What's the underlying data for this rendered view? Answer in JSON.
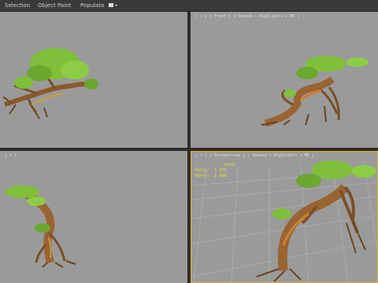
{
  "menubar": {
    "items": [
      "Selection",
      "Object Paint",
      "Populate"
    ],
    "extra_icon": "camera-dropdown-icon"
  },
  "viewports": [
    {
      "name": "top-left",
      "label": ""
    },
    {
      "name": "top-right",
      "label": "[ + ] [ Front ] [ Shaded + Highlights + ME ]"
    },
    {
      "name": "bottom-left",
      "label": "[ + ]"
    },
    {
      "name": "bottom-right",
      "label": "[ + ] [ Perspective ] [ Shaded + Highlights + ME ]"
    }
  ],
  "stats": {
    "lines": [
      "            Total",
      "Polys:  1 370",
      "Verts:  1 460"
    ]
  },
  "colors": {
    "viewport_bg": "#9a9a9a",
    "active_border": "#e8b020",
    "leaves": "#7fbf3a",
    "trunk": "#b07a3a",
    "stats": "#f0e020"
  }
}
